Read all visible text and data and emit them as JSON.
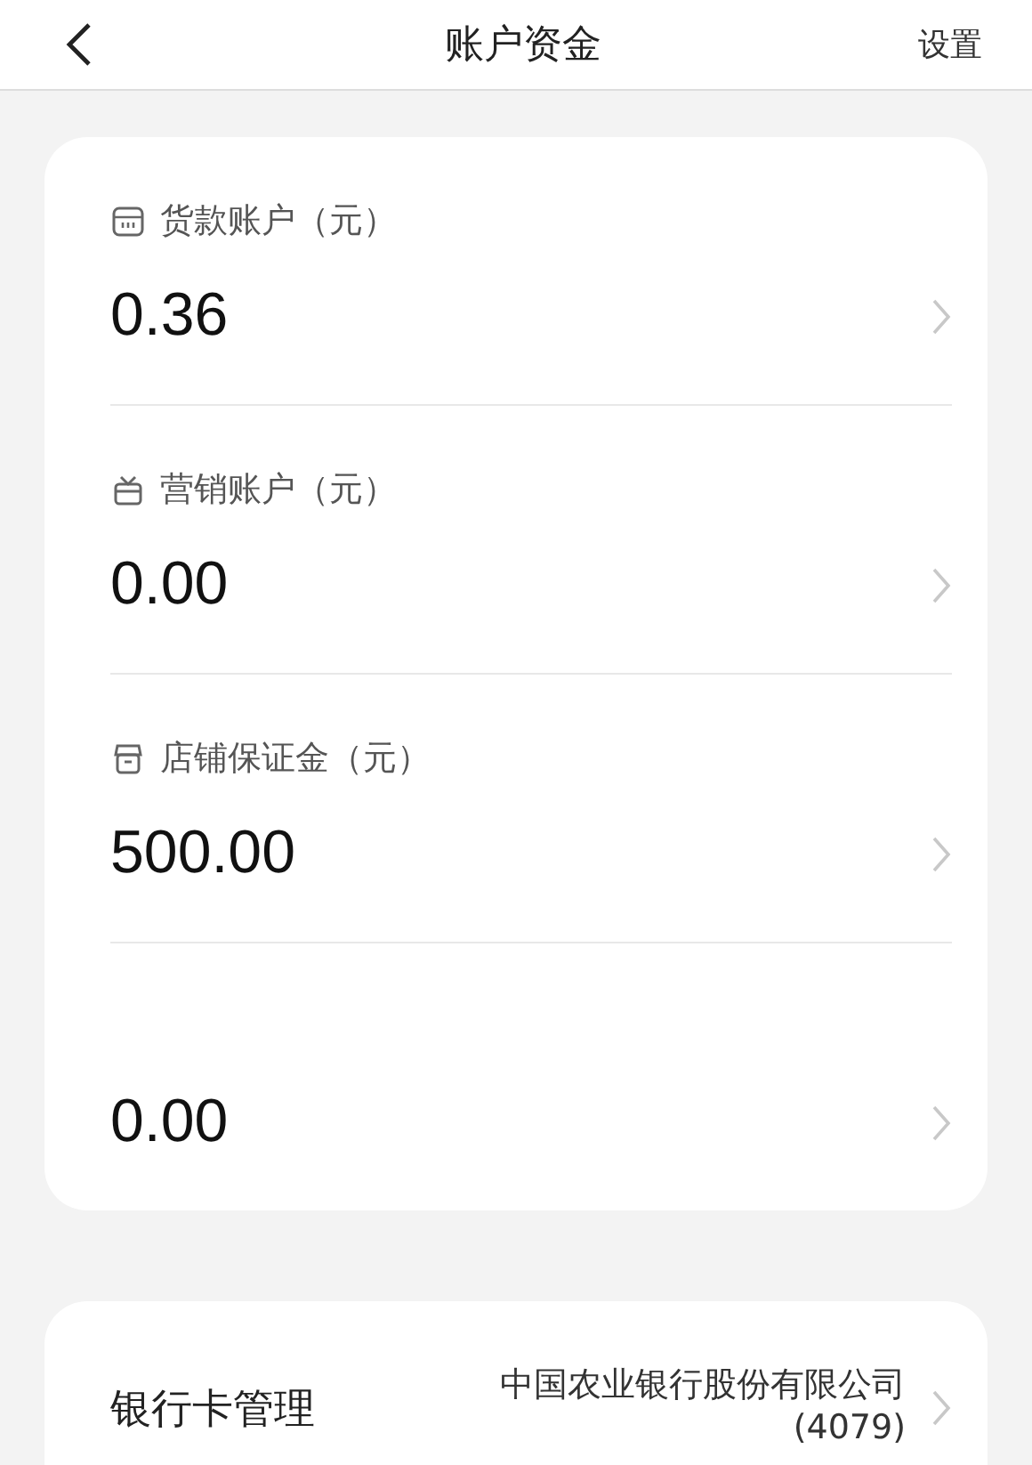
{
  "header": {
    "title": "账户资金",
    "action": "设置"
  },
  "accounts": [
    {
      "kind": "wallet",
      "label": "货款账户（元）",
      "value": "0.36"
    },
    {
      "kind": "gift",
      "label": "营销账户（元）",
      "value": "0.00"
    },
    {
      "kind": "shop",
      "label": "店铺保证金（元）",
      "value": "500.00"
    },
    {
      "kind": "plain",
      "value": "0.00"
    }
  ],
  "bank": {
    "label": "银行卡管理",
    "name": "中国农业银行股份有限公司",
    "number": "(4079)"
  }
}
